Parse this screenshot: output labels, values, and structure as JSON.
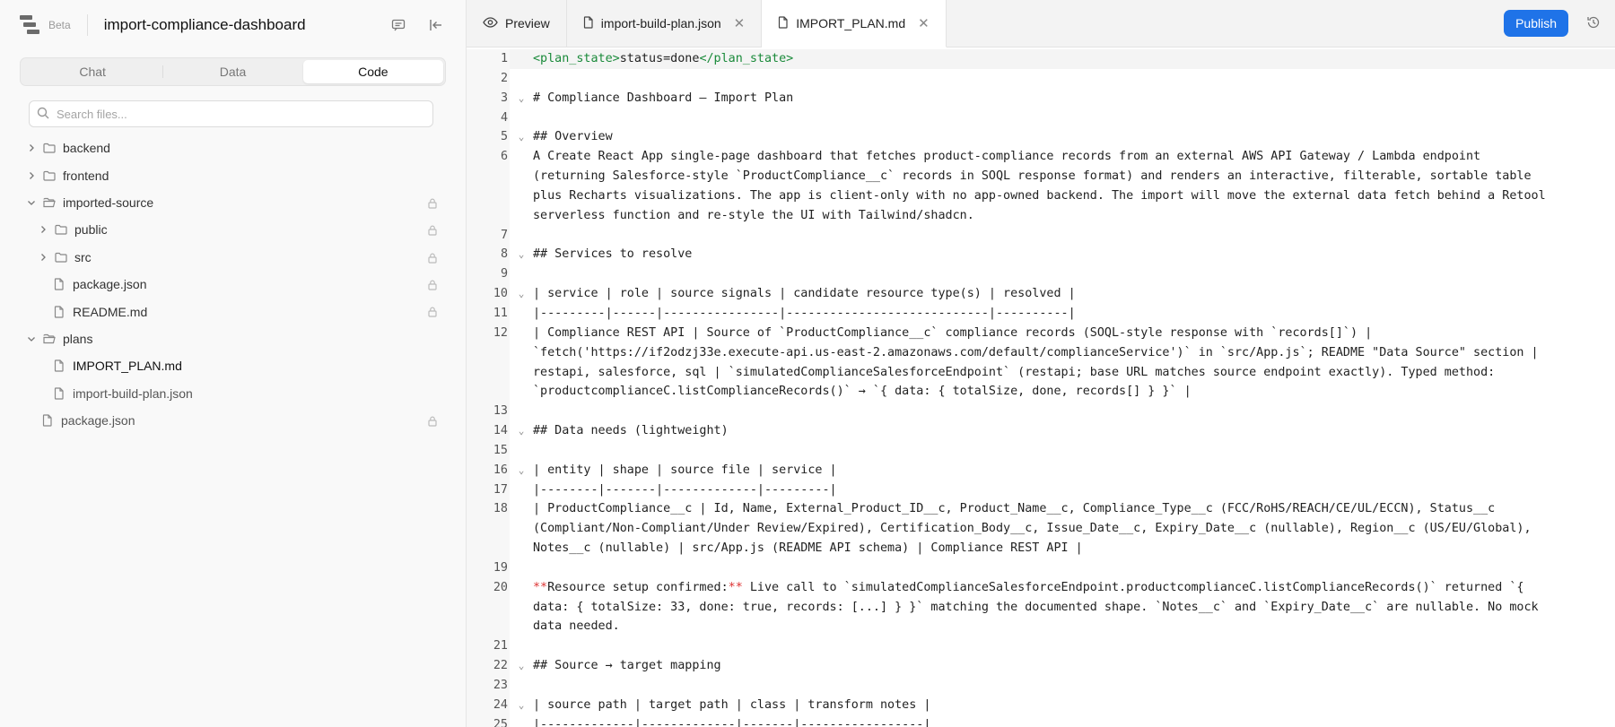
{
  "sidebar": {
    "beta_label": "Beta",
    "project_title": "import-compliance-dashboard",
    "tabs": [
      {
        "label": "Chat"
      },
      {
        "label": "Data"
      },
      {
        "label": "Code"
      }
    ],
    "search_placeholder": "Search files...",
    "tree": [
      {
        "label": "backend"
      },
      {
        "label": "frontend"
      },
      {
        "label": "imported-source"
      },
      {
        "label": "public"
      },
      {
        "label": "src"
      },
      {
        "label": "package.json"
      },
      {
        "label": "README.md"
      },
      {
        "label": "plans"
      },
      {
        "label": "IMPORT_PLAN.md"
      },
      {
        "label": "import-build-plan.json"
      },
      {
        "label": "package.json"
      }
    ]
  },
  "tabs": [
    {
      "label": "Preview"
    },
    {
      "label": "import-build-plan.json"
    },
    {
      "label": "IMPORT_PLAN.md"
    }
  ],
  "publish_label": "Publish",
  "editor": {
    "line_numbers": [
      "1",
      "2",
      "3",
      "4",
      "5",
      "6",
      "",
      "",
      "7",
      "8",
      "9",
      "10",
      "11",
      "12",
      "",
      "",
      "",
      "13",
      "14",
      "15",
      "16",
      "17",
      "18",
      "",
      "",
      "19",
      "20",
      "",
      "",
      "21",
      "22",
      "23",
      "24",
      "25"
    ],
    "lines": {
      "l1_open": "<plan_state>",
      "l1_mid": "status=done",
      "l1_close": "</plan_state>",
      "l3": "# Compliance Dashboard — Import Plan",
      "l5": "## Overview",
      "l6a": "A Create React App single-page dashboard that fetches product-compliance records from an external AWS API Gateway / Lambda endpoint",
      "l6b": "(returning Salesforce-style `ProductCompliance__c` records in SOQL response format) and renders an interactive, filterable, sortable table",
      "l6c": "plus Recharts visualizations. The app is client-only with no app-owned backend. The import will move the external data fetch behind a Retool",
      "l6d": "serverless function and re-style the UI with Tailwind/shadcn.",
      "l8": "## Services to resolve",
      "l10": "| service | role | source signals | candidate resource type(s) | resolved |",
      "l11": "|---------|------|----------------|----------------------------|----------|",
      "l12a": "| Compliance REST API | Source of `ProductCompliance__c` compliance records (SOQL-style response with `records[]`) |",
      "l12b": "`fetch('https://if2odzj33e.execute-api.us-east-2.amazonaws.com/default/complianceService')` in `src/App.js`; README \"Data Source\" section |",
      "l12c": "restapi, salesforce, sql | `simulatedComplianceSalesforceEndpoint` (restapi; base URL matches source endpoint exactly). Typed method:",
      "l12d": "`productcomplianceC.listComplianceRecords()` → `{ data: { totalSize, done, records[] } }` |",
      "l14": "## Data needs (lightweight)",
      "l16": "| entity | shape | source file | service |",
      "l17": "|--------|-------|-------------|---------|",
      "l18a": "| ProductCompliance__c | Id, Name, External_Product_ID__c, Product_Name__c, Compliance_Type__c (FCC/RoHS/REACH/CE/UL/ECCN), Status__c",
      "l18b": "(Compliant/Non-Compliant/Under Review/Expired), Certification_Body__c, Issue_Date__c, Expiry_Date__c (nullable), Region__c (US/EU/Global),",
      "l18c": "Notes__c (nullable) | src/App.js (README API schema) | Compliance REST API |",
      "l20_mark": "**",
      "l20_bold": "Resource setup confirmed:",
      "l20a_rest": " Live call to `simulatedComplianceSalesforceEndpoint.productcomplianceC.listComplianceRecords()` returned `{",
      "l20b": "data: { totalSize: 33, done: true, records: [...] } }` matching the documented shape. `Notes__c` and `Expiry_Date__c` are nullable. No mock",
      "l20c": "data needed.",
      "l22": "## Source → target mapping",
      "l24": "| source path | target path | class | transform notes |",
      "l25": "|-------------|-------------|-------|-----------------|"
    }
  }
}
